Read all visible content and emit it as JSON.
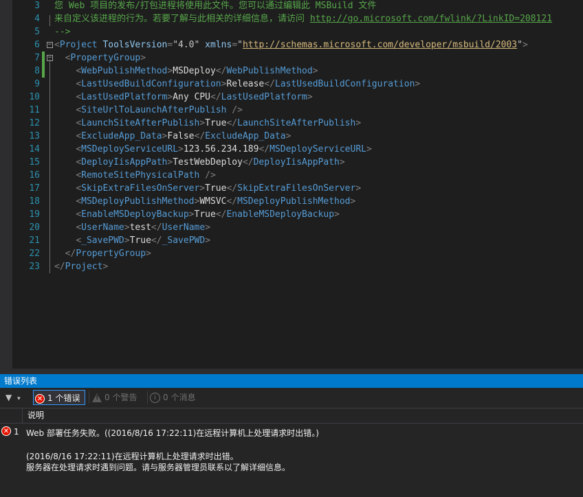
{
  "editor": {
    "lines": [
      {
        "num": "3",
        "parts": [
          [
            "c",
            "您 Web 项目的发布/打包进程将使用此文件。您可以通过编辑此 MSBuild 文件"
          ]
        ]
      },
      {
        "num": "4",
        "parts": [
          [
            "c",
            "来自定义该进程的行为。若要了解与此相关的详细信息，请访问 "
          ],
          [
            "cu",
            "http://go.microsoft.com/fwlink/?LinkID=208121"
          ]
        ]
      },
      {
        "num": "5",
        "parts": [
          [
            "c",
            "-->"
          ]
        ]
      },
      {
        "num": "6",
        "parts": [
          [
            "b",
            "<"
          ],
          [
            "t",
            "Project"
          ],
          [
            "a",
            " ToolsVersion"
          ],
          [
            "b",
            "="
          ],
          [
            "s",
            "\"4.0\""
          ],
          [
            "a",
            " xmlns"
          ],
          [
            "b",
            "="
          ],
          [
            "s",
            "\""
          ],
          [
            "u",
            "http://schemas.microsoft.com/developer/msbuild/2003"
          ],
          [
            "s",
            "\""
          ],
          [
            "b",
            ">"
          ]
        ]
      },
      {
        "num": "7",
        "parts": [
          [
            "x",
            "  "
          ],
          [
            "b",
            "<"
          ],
          [
            "t",
            "PropertyGroup"
          ],
          [
            "b",
            ">"
          ]
        ]
      },
      {
        "num": "8",
        "parts": [
          [
            "x",
            "    "
          ],
          [
            "b",
            "<"
          ],
          [
            "t",
            "WebPublishMethod"
          ],
          [
            "b",
            ">"
          ],
          [
            "x",
            "MSDeploy"
          ],
          [
            "b",
            "</"
          ],
          [
            "t",
            "WebPublishMethod"
          ],
          [
            "b",
            ">"
          ]
        ]
      },
      {
        "num": "9",
        "parts": [
          [
            "x",
            "    "
          ],
          [
            "b",
            "<"
          ],
          [
            "t",
            "LastUsedBuildConfiguration"
          ],
          [
            "b",
            ">"
          ],
          [
            "x",
            "Release"
          ],
          [
            "b",
            "</"
          ],
          [
            "t",
            "LastUsedBuildConfiguration"
          ],
          [
            "b",
            ">"
          ]
        ]
      },
      {
        "num": "10",
        "parts": [
          [
            "x",
            "    "
          ],
          [
            "b",
            "<"
          ],
          [
            "t",
            "LastUsedPlatform"
          ],
          [
            "b",
            ">"
          ],
          [
            "x",
            "Any CPU"
          ],
          [
            "b",
            "</"
          ],
          [
            "t",
            "LastUsedPlatform"
          ],
          [
            "b",
            ">"
          ]
        ]
      },
      {
        "num": "11",
        "parts": [
          [
            "x",
            "    "
          ],
          [
            "b",
            "<"
          ],
          [
            "t",
            "SiteUrlToLaunchAfterPublish"
          ],
          [
            "b",
            " />"
          ]
        ]
      },
      {
        "num": "12",
        "parts": [
          [
            "x",
            "    "
          ],
          [
            "b",
            "<"
          ],
          [
            "t",
            "LaunchSiteAfterPublish"
          ],
          [
            "b",
            ">"
          ],
          [
            "x",
            "True"
          ],
          [
            "b",
            "</"
          ],
          [
            "t",
            "LaunchSiteAfterPublish"
          ],
          [
            "b",
            ">"
          ]
        ]
      },
      {
        "num": "13",
        "parts": [
          [
            "x",
            "    "
          ],
          [
            "b",
            "<"
          ],
          [
            "t",
            "ExcludeApp_Data"
          ],
          [
            "b",
            ">"
          ],
          [
            "x",
            "False"
          ],
          [
            "b",
            "</"
          ],
          [
            "t",
            "ExcludeApp_Data"
          ],
          [
            "b",
            ">"
          ]
        ]
      },
      {
        "num": "14",
        "parts": [
          [
            "x",
            "    "
          ],
          [
            "b",
            "<"
          ],
          [
            "t",
            "MSDeployServiceURL"
          ],
          [
            "b",
            ">"
          ],
          [
            "x",
            "123.56.234.189"
          ],
          [
            "b",
            "</"
          ],
          [
            "t",
            "MSDeployServiceURL"
          ],
          [
            "b",
            ">"
          ]
        ]
      },
      {
        "num": "15",
        "parts": [
          [
            "x",
            "    "
          ],
          [
            "b",
            "<"
          ],
          [
            "t",
            "DeployIisAppPath"
          ],
          [
            "b",
            ">"
          ],
          [
            "x",
            "TestWebDeploy"
          ],
          [
            "b",
            "</"
          ],
          [
            "t",
            "DeployIisAppPath"
          ],
          [
            "b",
            ">"
          ]
        ]
      },
      {
        "num": "16",
        "parts": [
          [
            "x",
            "    "
          ],
          [
            "b",
            "<"
          ],
          [
            "t",
            "RemoteSitePhysicalPath"
          ],
          [
            "b",
            " />"
          ]
        ]
      },
      {
        "num": "17",
        "parts": [
          [
            "x",
            "    "
          ],
          [
            "b",
            "<"
          ],
          [
            "t",
            "SkipExtraFilesOnServer"
          ],
          [
            "b",
            ">"
          ],
          [
            "x",
            "True"
          ],
          [
            "b",
            "</"
          ],
          [
            "t",
            "SkipExtraFilesOnServer"
          ],
          [
            "b",
            ">"
          ]
        ]
      },
      {
        "num": "18",
        "parts": [
          [
            "x",
            "    "
          ],
          [
            "b",
            "<"
          ],
          [
            "t",
            "MSDeployPublishMethod"
          ],
          [
            "b",
            ">"
          ],
          [
            "x",
            "WMSVC"
          ],
          [
            "b",
            "</"
          ],
          [
            "t",
            "MSDeployPublishMethod"
          ],
          [
            "b",
            ">"
          ]
        ]
      },
      {
        "num": "19",
        "parts": [
          [
            "x",
            "    "
          ],
          [
            "b",
            "<"
          ],
          [
            "t",
            "EnableMSDeployBackup"
          ],
          [
            "b",
            ">"
          ],
          [
            "x",
            "True"
          ],
          [
            "b",
            "</"
          ],
          [
            "t",
            "EnableMSDeployBackup"
          ],
          [
            "b",
            ">"
          ]
        ]
      },
      {
        "num": "20",
        "parts": [
          [
            "x",
            "    "
          ],
          [
            "b",
            "<"
          ],
          [
            "t",
            "UserName"
          ],
          [
            "b",
            ">"
          ],
          [
            "x",
            "test"
          ],
          [
            "b",
            "</"
          ],
          [
            "t",
            "UserName"
          ],
          [
            "b",
            ">"
          ]
        ]
      },
      {
        "num": "21",
        "parts": [
          [
            "x",
            "    "
          ],
          [
            "b",
            "<"
          ],
          [
            "t",
            "_SavePWD"
          ],
          [
            "b",
            ">"
          ],
          [
            "x",
            "True"
          ],
          [
            "b",
            "</"
          ],
          [
            "t",
            "_SavePWD"
          ],
          [
            "b",
            ">"
          ]
        ]
      },
      {
        "num": "22",
        "parts": [
          [
            "x",
            "  "
          ],
          [
            "b",
            "</"
          ],
          [
            "t",
            "PropertyGroup"
          ],
          [
            "b",
            ">"
          ]
        ]
      },
      {
        "num": "23",
        "parts": [
          [
            "b",
            "</"
          ],
          [
            "t",
            "Project"
          ],
          [
            "b",
            ">"
          ]
        ]
      }
    ]
  },
  "error_list": {
    "title": "错误列表",
    "errors_label": "1 个错误",
    "warnings_label": "0 个警告",
    "messages_label": "0 个消息",
    "column_description": "说明",
    "rows": [
      {
        "number": "1",
        "line1": "Web 部署任务失败。((2016/8/16 17:22:11)在远程计算机上处理请求时出错。)",
        "line2": "(2016/8/16 17:22:11)在远程计算机上处理请求时出错。",
        "line3": "服务器在处理请求时遇到问题。请与服务器管理员联系以了解详细信息。"
      }
    ]
  },
  "colors": {
    "accent": "#007acc",
    "error": "#e51400",
    "changed_line": "#57a64a"
  }
}
